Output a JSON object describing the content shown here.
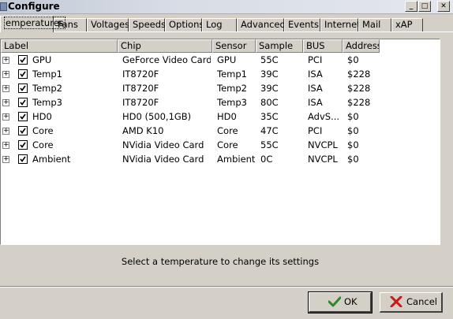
{
  "window": {
    "title": "Configure",
    "minimize_glyph": "_",
    "maximize_glyph": "□",
    "close_glyph": "✕"
  },
  "tabs": [
    {
      "label": "emperatures",
      "active": true
    },
    {
      "label": "Fans"
    },
    {
      "label": "Voltages"
    },
    {
      "label": "Speeds"
    },
    {
      "label": "Options"
    },
    {
      "label": "Log"
    },
    {
      "label": "Advanced"
    },
    {
      "label": "Events"
    },
    {
      "label": "Internet"
    },
    {
      "label": "Mail"
    },
    {
      "label": "xAP"
    }
  ],
  "columns": [
    "Label",
    "Chip",
    "Sensor",
    "Sample",
    "BUS",
    "Address"
  ],
  "rows": [
    {
      "label": "GPU",
      "chip": "GeForce Video Card",
      "sensor": "GPU",
      "sample": "55C",
      "bus": "PCI",
      "address": "$0",
      "checked": true
    },
    {
      "label": "Temp1",
      "chip": "IT8720F",
      "sensor": "Temp1",
      "sample": "39C",
      "bus": "ISA",
      "address": "$228",
      "checked": true
    },
    {
      "label": "Temp2",
      "chip": "IT8720F",
      "sensor": "Temp2",
      "sample": "39C",
      "bus": "ISA",
      "address": "$228",
      "checked": true
    },
    {
      "label": "Temp3",
      "chip": "IT8720F",
      "sensor": "Temp3",
      "sample": "80C",
      "bus": "ISA",
      "address": "$228",
      "checked": true
    },
    {
      "label": "HD0",
      "chip": "HD0 (500,1GB)",
      "sensor": "HD0",
      "sample": "35C",
      "bus": "AdvS...",
      "address": "$0",
      "checked": true
    },
    {
      "label": "Core",
      "chip": "AMD K10",
      "sensor": "Core",
      "sample": "47C",
      "bus": "PCI",
      "address": "$0",
      "checked": true
    },
    {
      "label": "Core",
      "chip": "NVidia Video Card",
      "sensor": "Core",
      "sample": "55C",
      "bus": "NVCPL",
      "address": "$0",
      "checked": true
    },
    {
      "label": "Ambient",
      "chip": "NVidia Video Card",
      "sensor": "Ambient",
      "sample": "0C",
      "bus": "NVCPL",
      "address": "$0",
      "checked": true
    }
  ],
  "expander_glyph": "+",
  "status_text": "Select a temperature to change its settings",
  "buttons": {
    "ok": {
      "label": "OK",
      "icon": "checkmark-icon",
      "color": "#2a8a2a"
    },
    "cancel": {
      "label": "Cancel",
      "icon": "red-x-icon",
      "color": "#c81818"
    }
  }
}
